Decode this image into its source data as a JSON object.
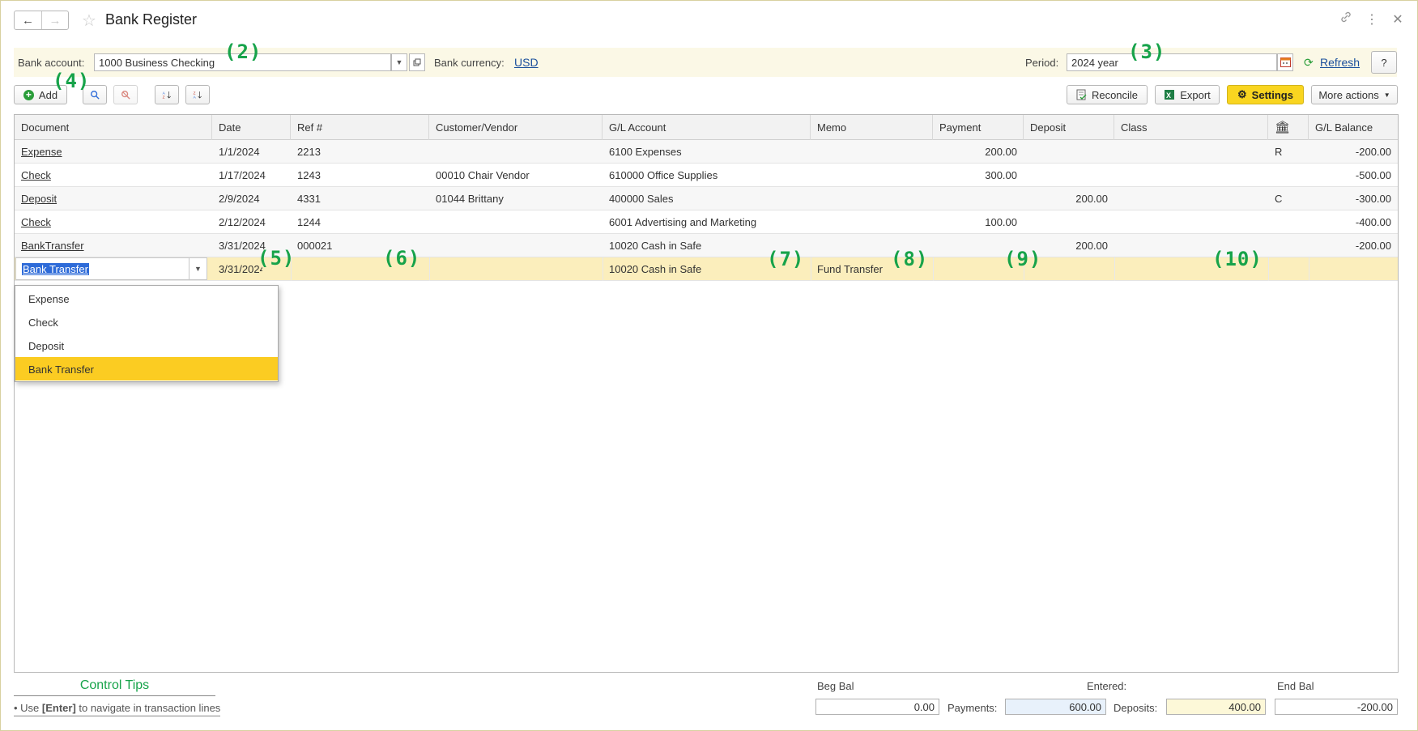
{
  "window": {
    "title": "Bank Register",
    "back_icon": "←",
    "forward_icon": "→",
    "star_icon": "☆",
    "link_icon": "🔗",
    "more_icon": "⋮",
    "close_icon": "✕"
  },
  "filters": {
    "bank_account_label": "Bank account:",
    "bank_account_value": "1000 Business Checking",
    "bank_currency_label": "Bank currency:",
    "bank_currency_value": "USD",
    "period_label": "Period:",
    "period_value": "2024 year",
    "refresh_label": "Refresh",
    "help_label": "?"
  },
  "toolbar": {
    "add_label": "Add",
    "reconcile_label": "Reconcile",
    "export_label": "Export",
    "settings_label": "Settings",
    "more_actions_label": "More actions"
  },
  "markers": {
    "m2": "(2)",
    "m3": "(3)",
    "m4": "(4)",
    "m5": "(5)",
    "m6": "(6)",
    "m7": "(7)",
    "m8": "(8)",
    "m9": "(9)",
    "m10": "(10)"
  },
  "table": {
    "headers": [
      "Document",
      "Date",
      "Ref #",
      "Customer/Vendor",
      "G/L Account",
      "Memo",
      "Payment",
      "Deposit",
      "Class",
      "🏛",
      "G/L Balance"
    ],
    "rows": [
      {
        "document": "Expense",
        "date": "1/1/2024",
        "ref": "2213",
        "cust": "",
        "gl": "6100 Expenses",
        "memo": "",
        "payment": "200.00",
        "deposit": "",
        "class": "",
        "rec": "R",
        "balance": "-200.00"
      },
      {
        "document": "Check",
        "date": "1/17/2024",
        "ref": "1243",
        "cust": "00010 Chair Vendor",
        "gl": "610000 Office Supplies",
        "memo": "",
        "payment": "300.00",
        "deposit": "",
        "class": "",
        "rec": "",
        "balance": "-500.00"
      },
      {
        "document": "Deposit",
        "date": "2/9/2024",
        "ref": "4331",
        "cust": "01044 Brittany",
        "gl": "400000 Sales",
        "memo": "",
        "payment": "",
        "deposit": "200.00",
        "class": "",
        "rec": "C",
        "balance": "-300.00"
      },
      {
        "document": "Check",
        "date": "2/12/2024",
        "ref": "1244",
        "cust": "",
        "gl": "6001 Advertising and Marketing",
        "memo": "",
        "payment": "100.00",
        "deposit": "",
        "class": "",
        "rec": "",
        "balance": "-400.00"
      },
      {
        "document": "BankTransfer",
        "date": "3/31/2024",
        "ref": "000021",
        "cust": "",
        "gl": "10020 Cash in Safe",
        "memo": "",
        "payment": "",
        "deposit": "200.00",
        "class": "",
        "rec": "",
        "balance": "-200.00"
      }
    ],
    "edit_row": {
      "document": "Bank Transfer",
      "date": "3/31/2024",
      "ref": "",
      "cust": "",
      "gl": "10020 Cash in Safe",
      "memo": "Fund Transfer",
      "payment": "",
      "deposit": "",
      "class": "",
      "rec": "",
      "balance": ""
    }
  },
  "dropdown": {
    "options": [
      "Expense",
      "Check",
      "Deposit",
      "Bank Transfer"
    ],
    "selected": "Bank Transfer"
  },
  "footer": {
    "tips_title": "Control Tips",
    "tips_text_prefix": "• Use ",
    "tips_text_key": "[Enter]",
    "tips_text_suffix": " to navigate in transaction lines",
    "beg_bal_label": "Beg Bal",
    "beg_bal_value": "0.00",
    "entered_label": "Entered:",
    "payments_label": "Payments:",
    "payments_value": "600.00",
    "deposits_label": "Deposits:",
    "deposits_value": "400.00",
    "end_bal_label": "End Bal",
    "end_bal_value": "-200.00"
  },
  "colors": {
    "accent_yellow": "#f9d520",
    "marker_green": "#17a34a",
    "link_blue": "#1a4f9c",
    "active_row": "#fbeebc"
  }
}
